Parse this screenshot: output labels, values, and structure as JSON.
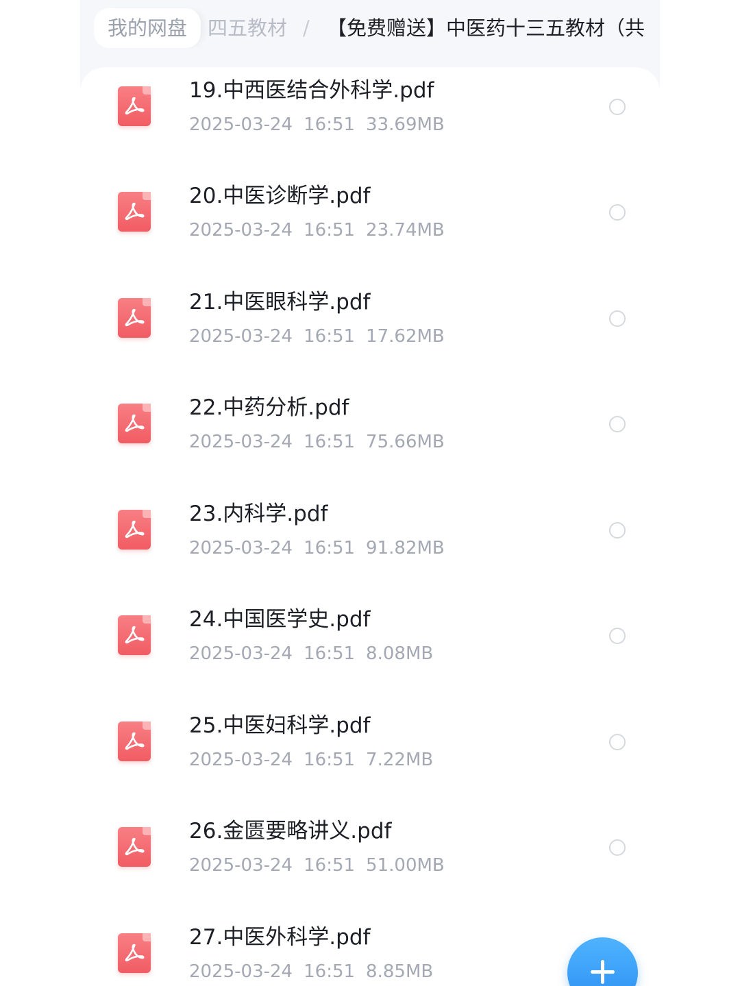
{
  "breadcrumb": {
    "root": "我的网盘",
    "middle": "四五教材",
    "separator": "/",
    "current": "【免费赠送】中医药十三五教材（共"
  },
  "files": [
    {
      "name": "19.中西医结合外科学.pdf",
      "date": "2025-03-24",
      "time": "16:51",
      "size": "33.69MB"
    },
    {
      "name": "20.中医诊断学.pdf",
      "date": "2025-03-24",
      "time": "16:51",
      "size": "23.74MB"
    },
    {
      "name": "21.中医眼科学.pdf",
      "date": "2025-03-24",
      "time": "16:51",
      "size": "17.62MB"
    },
    {
      "name": "22.中药分析.pdf",
      "date": "2025-03-24",
      "time": "16:51",
      "size": "75.66MB"
    },
    {
      "name": "23.内科学.pdf",
      "date": "2025-03-24",
      "time": "16:51",
      "size": "91.82MB"
    },
    {
      "name": "24.中国医学史.pdf",
      "date": "2025-03-24",
      "time": "16:51",
      "size": "8.08MB"
    },
    {
      "name": "25.中医妇科学.pdf",
      "date": "2025-03-24",
      "time": "16:51",
      "size": "7.22MB"
    },
    {
      "name": "26.金匮要略讲义.pdf",
      "date": "2025-03-24",
      "time": "16:51",
      "size": "51.00MB"
    },
    {
      "name": "27.中医外科学.pdf",
      "date": "2025-03-24",
      "time": "16:51",
      "size": "8.85MB"
    }
  ],
  "icons": {
    "file": "pdf-file-icon",
    "select": "radio-circle-icon",
    "fab": "plus-icon"
  },
  "colors": {
    "pdf_icon": "#f15c63",
    "fab": "#2b8ff2",
    "meta_text": "#a3a8b3",
    "title_text": "#1c1f25"
  }
}
